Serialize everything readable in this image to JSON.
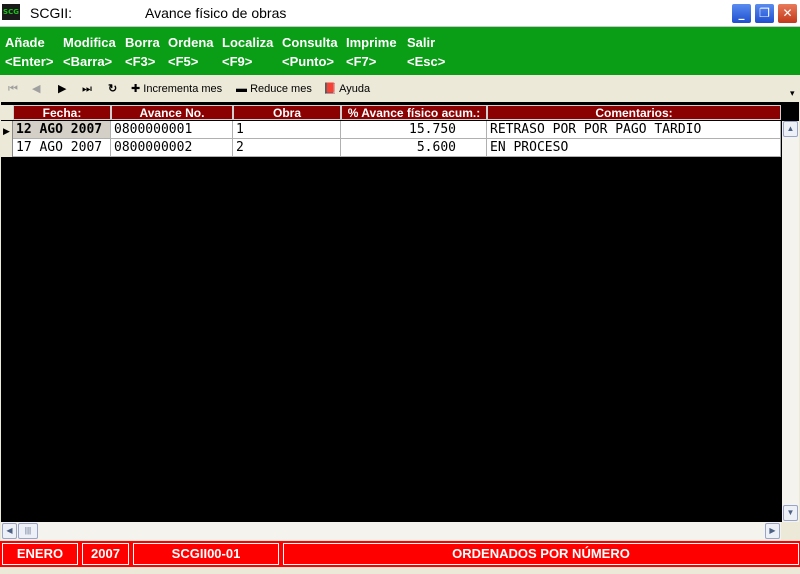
{
  "window": {
    "app_name": "SCGII:",
    "title": "Avance físico de obras",
    "icon_text": "SCG",
    "minimize_glyph": "_",
    "maximize_glyph": "❐",
    "close_glyph": "✕"
  },
  "menu": [
    {
      "label": "Añade",
      "key": "<Enter>"
    },
    {
      "label": "Modifica",
      "key": "<Barra>"
    },
    {
      "label": "Borra",
      "key": "<F3>"
    },
    {
      "label": "Ordena",
      "key": "<F5>"
    },
    {
      "label": "Localiza",
      "key": "<F9>"
    },
    {
      "label": "Consulta",
      "key": "<Punto>"
    },
    {
      "label": "Imprime",
      "key": "<F7>"
    },
    {
      "label": "Salir",
      "key": "<Esc>"
    }
  ],
  "toolbar": {
    "first_glyph": "⏮",
    "prev_glyph": "◀",
    "next_glyph": "▶",
    "last_glyph": "⏭",
    "refresh_glyph": "↻",
    "increment_glyph": "✚",
    "increment_label": "Incrementa mes",
    "reduce_glyph": "▬",
    "reduce_label": "Reduce mes",
    "help_glyph": "📕",
    "help_label": "Ayuda",
    "overflow_glyph": "▾"
  },
  "grid": {
    "columns": [
      "Fecha:",
      "Avance No.",
      "Obra",
      "% Avance físico acum.:",
      "Comentarios:"
    ],
    "rows": [
      {
        "fecha": "12 AGO 2007",
        "avance": "0800000001",
        "obra": "1",
        "pct": "15.750",
        "comentarios": "RETRASO POR POR PAGO TARDIO",
        "selected": true
      },
      {
        "fecha": "17 AGO 2007",
        "avance": "0800000002",
        "obra": "2",
        "pct": "5.600",
        "comentarios": "EN PROCESO",
        "selected": false
      }
    ],
    "row_indicator_glyph": "▶",
    "scroll_up_glyph": "▲",
    "scroll_down_glyph": "▼",
    "scroll_left_glyph": "◀",
    "scroll_right_glyph": "▶",
    "thumb_glyph": "≡",
    "hthumb_glyph": "|||"
  },
  "status": {
    "month": "ENERO",
    "year": "2007",
    "code": "SCGII00-01",
    "message": "ORDENADOS POR NÚMERO"
  },
  "colors": {
    "menubar": "#0a9e16",
    "header": "#8b0000",
    "statusbar": "#ff0000",
    "grid_bg": "#000000"
  }
}
